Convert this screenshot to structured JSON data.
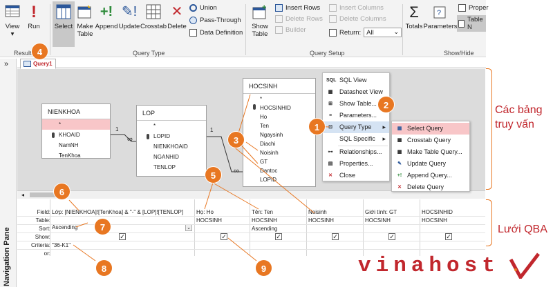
{
  "ribbon": {
    "view": "View",
    "run": "Run",
    "results_group": "Results",
    "select": "Select",
    "make_table": "Make Table",
    "append": "Append",
    "update": "Update",
    "crosstab": "Crosstab",
    "delete": "Delete",
    "union": "Union",
    "pass_through": "Pass-Through",
    "data_definition": "Data Definition",
    "query_type_group": "Query Type",
    "show_table": "Show Table",
    "insert_rows": "Insert Rows",
    "delete_rows": "Delete Rows",
    "builder": "Builder",
    "insert_columns": "Insert Columns",
    "delete_columns": "Delete Columns",
    "return_label": "Return:",
    "return_value": "All",
    "query_setup_group": "Query Setup",
    "totals": "Totals",
    "parameters": "Parameters",
    "property_sheet": "Proper",
    "table_names": "Table N",
    "show_hide_group": "Show/Hide"
  },
  "nav": {
    "label": "Navigation Pane",
    "toggle": "»"
  },
  "tab": {
    "label": "Query1"
  },
  "tables": [
    {
      "name": "NIENKHOA",
      "fields": [
        "*",
        "KHOAID",
        "NamNH",
        "TenKhoa"
      ]
    },
    {
      "name": "LOP",
      "fields": [
        "*",
        "LOPID",
        "NIENKHOAID",
        "NGANHID",
        "TENLOP"
      ]
    },
    {
      "name": "HOCSINH",
      "fields": [
        "*",
        "HOCSINHID",
        "Ho",
        "Ten",
        "Ngaysinh",
        "Diachi",
        "Noisinh",
        "GT",
        "Dantoc",
        "LOPID"
      ]
    }
  ],
  "relations": {
    "one": "1",
    "many": "∞"
  },
  "context_menu": [
    {
      "icon": "SQL",
      "label": "SQL View"
    },
    {
      "icon": "▦",
      "label": "Datasheet View"
    },
    {
      "icon": "⊞",
      "label": "Show Table..."
    },
    {
      "icon": "≡",
      "label": "Parameters..."
    },
    {
      "icon": "⊡",
      "label": "Query Type"
    },
    {
      "icon": "",
      "label": "SQL Specific"
    },
    {
      "icon": "⊶",
      "label": "Relationships..."
    },
    {
      "icon": "▤",
      "label": "Properties..."
    },
    {
      "icon": "✕",
      "label": "Close"
    }
  ],
  "submenu": [
    {
      "icon": "▦",
      "label": "Select Query"
    },
    {
      "icon": "▦",
      "label": "Crosstab Query"
    },
    {
      "icon": "▦",
      "label": "Make Table Query..."
    },
    {
      "icon": "✎",
      "label": "Update Query"
    },
    {
      "icon": "+!",
      "label": "Append Query..."
    },
    {
      "icon": "✕",
      "label": "Delete Query"
    }
  ],
  "grid": {
    "row_labels": [
      "Field:",
      "Table:",
      "Sort:",
      "Show:",
      "Criteria:",
      "or:"
    ],
    "columns": [
      {
        "field": "Lớp: [NIENKHOA]![TenKhoa] & \"-\" & [LOP]![TENLOP]",
        "table": "",
        "sort": "Ascending",
        "show": true,
        "criteria": "\"36-K1\""
      },
      {
        "field": "Họ: Ho",
        "table": "HOCSINH",
        "sort": "",
        "show": true,
        "criteria": ""
      },
      {
        "field": "Tên: Ten",
        "table": "HOCSINH",
        "sort": "Ascending",
        "show": true,
        "criteria": ""
      },
      {
        "field": "Noisinh",
        "table": "HOCSINH",
        "sort": "",
        "show": true,
        "criteria": ""
      },
      {
        "field": "Giới tính: GT",
        "table": "HOCSINH",
        "sort": "",
        "show": true,
        "criteria": ""
      },
      {
        "field": "HOCSINHID",
        "table": "HOCSINH",
        "sort": "",
        "show": true,
        "criteria": ""
      }
    ]
  },
  "annotations": {
    "tables_label": "Các bảng\ntruy vấn",
    "grid_label": "Lưới QBA",
    "badges": [
      "1",
      "2",
      "3",
      "4",
      "5",
      "6",
      "7",
      "8",
      "9"
    ]
  },
  "logo": "vinahost",
  "colors": {
    "accent": "#e87722",
    "brand": "#c1272d",
    "highlight": "#f8c6c8",
    "menu_hover": "#d5e3f3"
  }
}
